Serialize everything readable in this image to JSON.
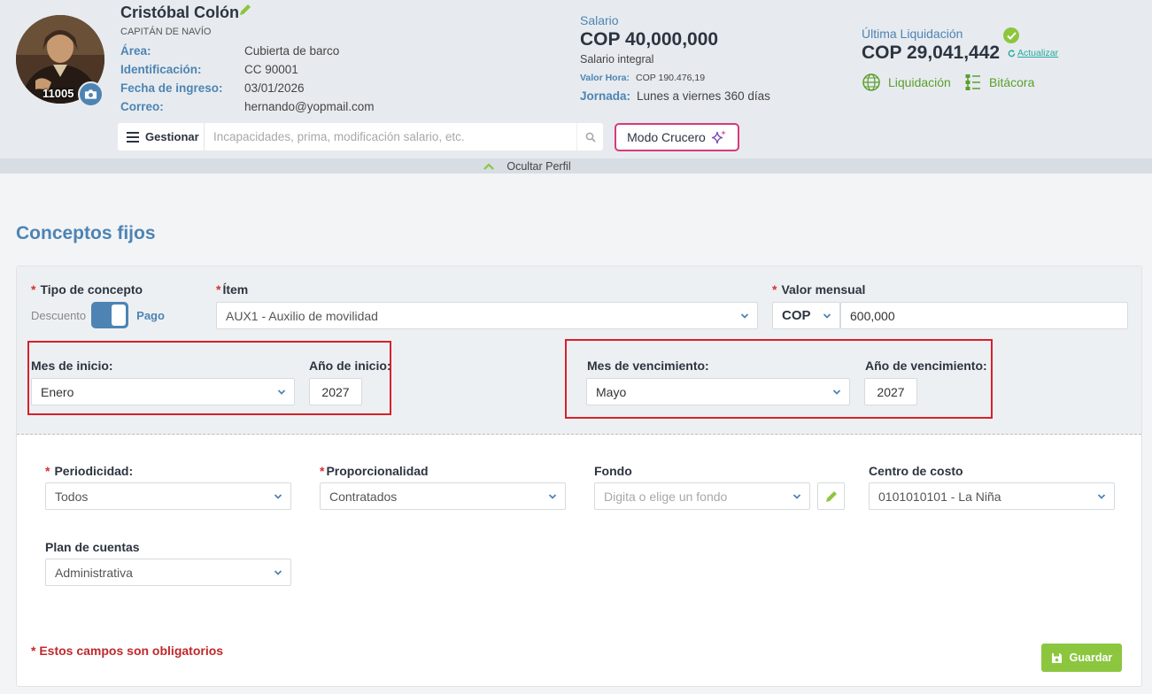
{
  "profile": {
    "name": "Cristóbal Colón",
    "title": "CAPITÁN DE NAVÍO",
    "employee_number": "11005",
    "fields": [
      {
        "label": "Área:",
        "value": "Cubierta de barco"
      },
      {
        "label": "Identificación:",
        "value": "CC 90001"
      },
      {
        "label": "Fecha de ingreso:",
        "value": "03/01/2026"
      },
      {
        "label": "Correo:",
        "value": "hernando@yopmail.com"
      }
    ]
  },
  "salary": {
    "label": "Salario",
    "value": "COP 40,000,000",
    "type": "Salario integral",
    "hour_label": "Valor Hora:",
    "hour_value": "COP 190.476,19",
    "schedule_label": "Jornada:",
    "schedule_value": "Lunes a viernes 360 días"
  },
  "settlement": {
    "label": "Última Liquidación",
    "value": "COP 29,041,442",
    "refresh_label": "Actualizar",
    "links": {
      "liquidacion": "Liquidación",
      "bitacora": "Bitácora"
    }
  },
  "toolbar": {
    "manage_label": "Gestionar",
    "search_placeholder": "Incapacidades, prima, modificación salario, etc.",
    "cruise_mode_label": "Modo Crucero"
  },
  "collapse": {
    "label": "Ocultar Perfil"
  },
  "section": {
    "title": "Conceptos fijos"
  },
  "form": {
    "concept_type": {
      "label": "Tipo de concepto",
      "off_label": "Descuento",
      "on_label": "Pago",
      "value": "Pago"
    },
    "item": {
      "label": "Ítem",
      "value": "AUX1 - Auxilio de movilidad"
    },
    "monthly_value": {
      "label": "Valor mensual",
      "currency": "COP",
      "amount": "600,000"
    },
    "start_month": {
      "label": "Mes de inicio:",
      "value": "Enero"
    },
    "start_year": {
      "label": "Año de inicio:",
      "value": "2027"
    },
    "end_month": {
      "label": "Mes de vencimiento:",
      "value": "Mayo"
    },
    "end_year": {
      "label": "Año de vencimiento:",
      "value": "2027"
    },
    "periodicity": {
      "label": "Periodicidad:",
      "value": "Todos"
    },
    "proportionality": {
      "label": "Proporcionalidad",
      "value": "Contratados"
    },
    "fund": {
      "label": "Fondo",
      "placeholder": "Digita o elige un fondo"
    },
    "cost_center": {
      "label": "Centro de costo",
      "value": "0101010101 - La Niña"
    },
    "accounts_plan": {
      "label": "Plan de cuentas",
      "value": "Administrativa"
    },
    "required_note": "* Estos campos son obligatorios",
    "save_label": "Guardar"
  },
  "colors": {
    "accent_blue": "#4d84b3",
    "success_green": "#8cc63f",
    "highlight_red": "#d8202a",
    "cruise_border": "#d63a7a"
  }
}
